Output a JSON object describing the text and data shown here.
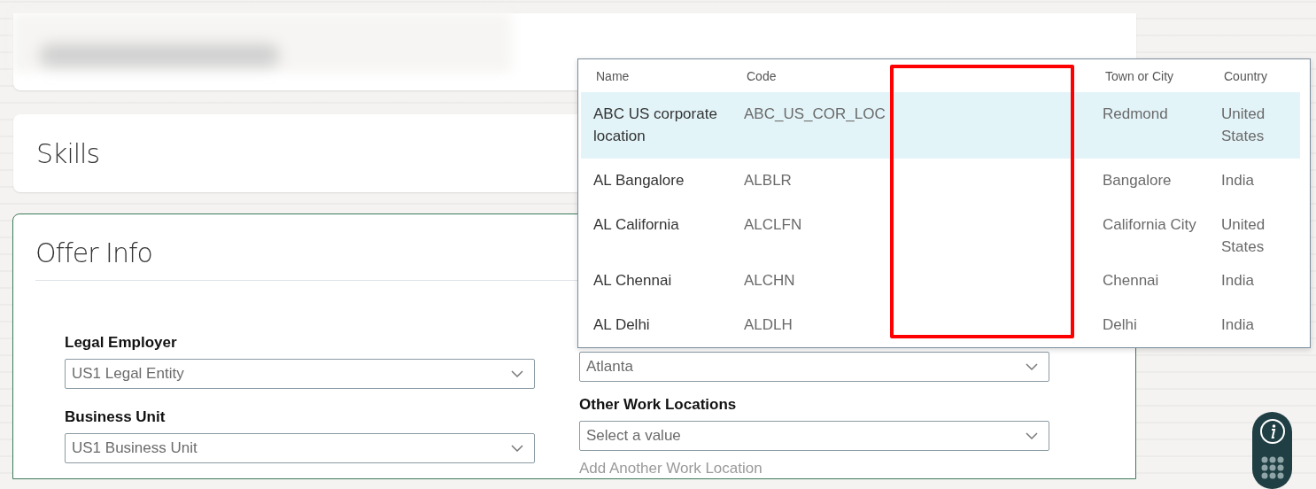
{
  "sections": [
    {
      "kind": "redacted"
    },
    {
      "kind": "titled",
      "title": "Skills"
    }
  ],
  "offer_info": {
    "title": "Offer Info",
    "left_fields": [
      {
        "label": "Legal Employer",
        "value": "US1 Legal Entity"
      },
      {
        "label": "Business Unit",
        "value": "US1 Business Unit"
      }
    ],
    "right_fields": [
      {
        "value": "Atlanta"
      },
      {
        "label": "Other Work Locations",
        "placeholder": "Select a value"
      }
    ],
    "add_link": "Add Another Work Location"
  },
  "location_popup": {
    "columns": [
      "Name",
      "Code",
      "",
      "Town or City",
      "Country"
    ],
    "rows": [
      {
        "name": "ABC US corporate location",
        "code": "ABC_US_COR_LOC",
        "town": "Redmond",
        "country": "United States",
        "selected": true
      },
      {
        "name": "AL Bangalore",
        "code": "ALBLR",
        "town": "Bangalore",
        "country": "India",
        "selected": false
      },
      {
        "name": "AL California",
        "code": "ALCLFN",
        "town": "California City",
        "country": "United States",
        "selected": false
      },
      {
        "name": "AL Chennai",
        "code": "ALCHN",
        "town": "Chennai",
        "country": "India",
        "selected": false
      },
      {
        "name": "AL Delhi",
        "code": "ALDLH",
        "town": "Delhi",
        "country": "India",
        "selected": false
      }
    ]
  },
  "annotation": {
    "kind": "rectangle"
  },
  "help_widget": {
    "kind": "info"
  }
}
